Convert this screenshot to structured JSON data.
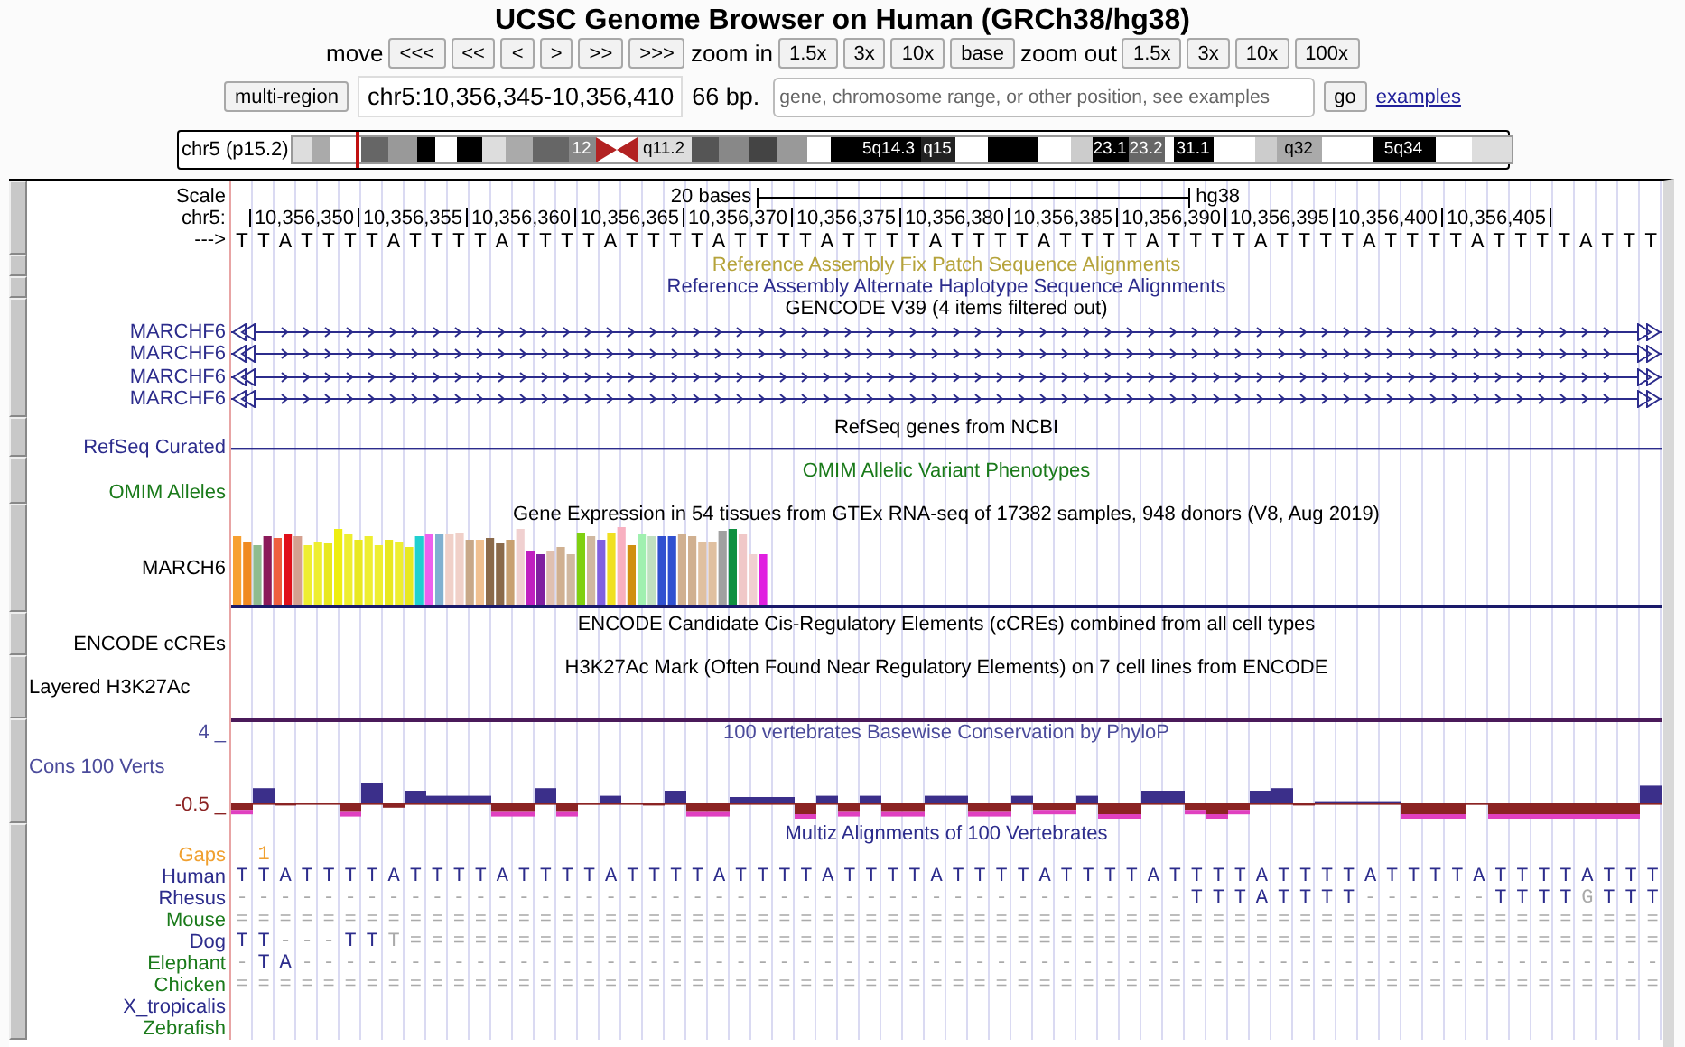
{
  "title": "UCSC Genome Browser on Human (GRCh38/hg38)",
  "navigation": {
    "move_label": "move",
    "move_buttons": [
      "<<<",
      "<<",
      "<",
      ">",
      ">>",
      ">>>"
    ],
    "zoom_in_label": "zoom in",
    "zoom_in_buttons": [
      "1.5x",
      "3x",
      "10x",
      "base"
    ],
    "zoom_out_label": "zoom out",
    "zoom_out_buttons": [
      "1.5x",
      "3x",
      "10x",
      "100x"
    ]
  },
  "position_bar": {
    "multi_region_button": "multi-region",
    "position": "chr5:10,356,345-10,356,410",
    "size": "66 bp.",
    "search_placeholder": "gene, chromosome range, or other position, see examples",
    "go_button": "go",
    "examples_link": "examples"
  },
  "ideogram": {
    "label": "chr5 (p15.2)",
    "band_labels": [
      "12",
      "q11.2",
      "5q14.3",
      "q15",
      "23.1",
      "23.2",
      "31.1",
      "q32",
      "5q34"
    ]
  },
  "ruler": {
    "scale_label": "Scale",
    "scale_bar": "20 bases",
    "assembly": "hg38",
    "chrom_label": "chr5:",
    "strand_label": "--->",
    "ticks": [
      "10,356,350",
      "10,356,355",
      "10,356,360",
      "10,356,365",
      "10,356,370",
      "10,356,375",
      "10,356,380",
      "10,356,385",
      "10,356,390",
      "10,356,395",
      "10,356,400",
      "10,356,405"
    ],
    "sequence": "TTATTTTATTTTATTTTATTTTATTTTATTTTATTTTATTTTATTTTATTTTATTTTATTTTATTT"
  },
  "tracks": [
    {
      "kind": "title_only",
      "title": "Reference Assembly Fix Patch Sequence Alignments",
      "color": "#b5a33a"
    },
    {
      "kind": "title_only",
      "title": "Reference Assembly Alternate Haplotype Sequence Alignments",
      "color": "#2c2c8c"
    },
    {
      "kind": "genes",
      "title": "GENCODE V39 (4 items filtered out)",
      "color": "#2c2c8c",
      "genes": [
        {
          "name": "MARCHF6"
        },
        {
          "name": "MARCHF6"
        },
        {
          "name": "MARCHF6"
        },
        {
          "name": "MARCHF6"
        }
      ]
    },
    {
      "kind": "line",
      "title": "RefSeq genes from NCBI",
      "label": "RefSeq Curated",
      "color": "#2c2c8c"
    },
    {
      "kind": "label",
      "title": "OMIM Allelic Variant Phenotypes",
      "label": "OMIM Alleles",
      "color": "#1a7a1a"
    },
    {
      "kind": "expression",
      "title": "Gene Expression in 54 tissues from GTEx RNA-seq of 17382 samples, 948 donors (V8, Aug 2019)",
      "label": "MARCH6"
    },
    {
      "kind": "label",
      "title": "ENCODE Candidate Cis-Regulatory Elements (cCREs) combined from all cell types",
      "label": "ENCODE cCREs"
    },
    {
      "kind": "layered",
      "title": "H3K27Ac Mark (Often Found Near Regulatory Elements) on 7 cell lines from ENCODE",
      "label": "Layered H3K27Ac"
    },
    {
      "kind": "wiggle",
      "title": "100 vertebrates Basewise Conservation by PhyloP",
      "label": "Cons 100 Verts",
      "color": "#4b4b9b",
      "max_label": "4 _",
      "min_label": "-0.5 _"
    },
    {
      "kind": "multiz",
      "title": "Multiz Alignments of 100 Vertebrates",
      "color": "#2c2c8c",
      "gaps_label": "Gaps",
      "gaps": " 1",
      "rows": [
        {
          "species": "Human",
          "color": "#2c2c8c",
          "sequence": "TTATTTTATTTTATTTTATTTTATTTTATTTTATTTTATTTTATTTTATTTTATTTTATTTTATTT"
        },
        {
          "species": "Rhesus",
          "color": "#2c2c8c",
          "sequence": "--------------------------------------------TTTATTTT------TTTTGTTT"
        },
        {
          "species": "Mouse",
          "color": "#1a7a1a",
          "sequence": "=================================================================="
        },
        {
          "species": "Dog",
          "color": "#2c2c8c",
          "sequence": "TT---TTT=========================================================="
        },
        {
          "species": "Elephant",
          "color": "#1a7a1a",
          "sequence": "-TA---------------------------------------------------------------"
        },
        {
          "species": "Chicken",
          "color": "#1a7a1a",
          "sequence": "=================================================================="
        },
        {
          "species": "X_tropicalis",
          "color": "#2c2c8c"
        },
        {
          "species": "Zebrafish",
          "color": "#1a7a1a"
        }
      ]
    }
  ]
}
